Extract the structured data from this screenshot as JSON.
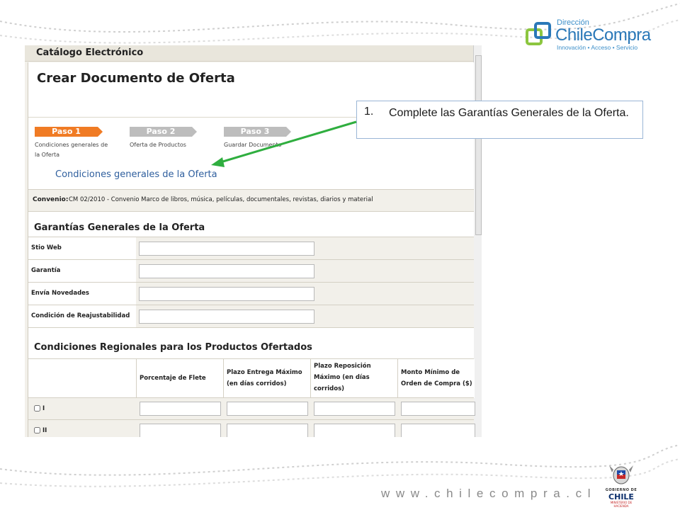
{
  "logo": {
    "small": "Dirección",
    "big": "ChileCompra",
    "tagline": "Innovación • Acceso • Servicio"
  },
  "app": {
    "section_title": "Catálogo Electrónico",
    "page_title": "Crear Documento de Oferta"
  },
  "steps": [
    {
      "label": "Paso 1",
      "desc": "Condiciones generales de la Oferta",
      "state": "active"
    },
    {
      "label": "Paso 2",
      "desc": "Oferta de Productos",
      "state": "inactive"
    },
    {
      "label": "Paso 3",
      "desc": "Guardar Documento",
      "state": "inactive"
    }
  ],
  "section_link": "Condiciones generales de la Oferta",
  "convenio": {
    "label": "Convenio:",
    "value": "CM 02/2010 - Convenio Marco de libros, música, películas, documentales, revistas, diarios y material"
  },
  "garantias": {
    "title": "Garantías Generales de la Oferta",
    "fields": [
      {
        "label": "Stio Web",
        "value": ""
      },
      {
        "label": "Garantía",
        "value": ""
      },
      {
        "label": "Envía Novedades",
        "value": ""
      },
      {
        "label": "Condición de Reajustabilidad",
        "value": ""
      }
    ]
  },
  "regionales": {
    "title": "Condiciones Regionales para los Productos Ofertados",
    "headers": [
      "Porcentaje de Flete",
      "Plazo Entrega Máximo (en días corridos)",
      "Plazo Reposición Máximo (en días corridos)",
      "Monto Mínimo de Orden de Compra ($)"
    ],
    "rows": [
      {
        "name": "I",
        "checked": false
      },
      {
        "name": "II",
        "checked": false
      }
    ]
  },
  "callout": {
    "number": "1.",
    "text": "Complete las Garantías Generales de la Oferta."
  },
  "footer": {
    "url": "www.chilecompra.cl",
    "gob_line1": "GOBIERNO DE",
    "gob_line2": "CHILE",
    "gob_line3": "MINISTERIO DE HACIENDA"
  },
  "colors": {
    "accent_orange": "#f07b24",
    "link_blue": "#2f5f9e",
    "arrow_green": "#2fae3f",
    "brand_blue": "#2a78b8",
    "brand_green": "#8cc63f"
  }
}
